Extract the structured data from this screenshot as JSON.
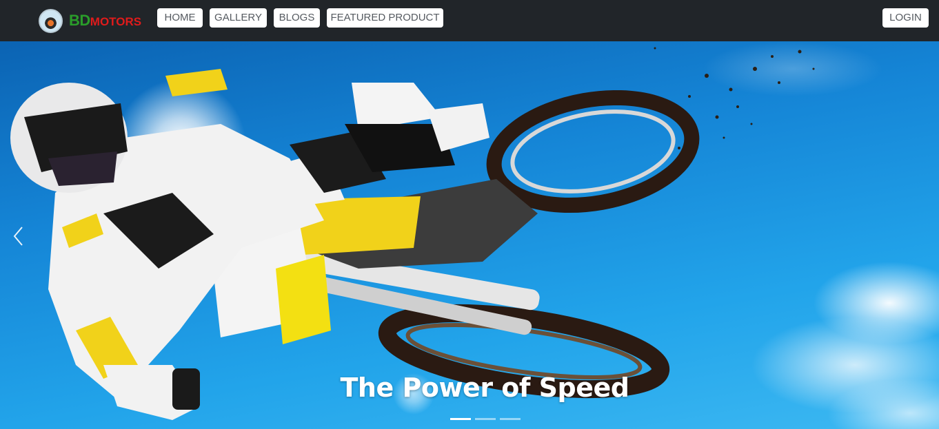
{
  "brand": {
    "name_part1": "BD",
    "name_part2": "MOTORS"
  },
  "nav": {
    "home": "HOME",
    "gallery": "GALLERY",
    "blogs": "BLOGS",
    "featured": "FEATURED PRODUCT",
    "login": "LOGIN"
  },
  "carousel": {
    "caption": "The Power of Speed",
    "slide_count": 3,
    "active_slide": 1
  },
  "colors": {
    "navbar": "#212529",
    "brand_bd": "#2a9d2a",
    "brand_motors": "#e01b1b",
    "sky": "#1e8fd8"
  }
}
